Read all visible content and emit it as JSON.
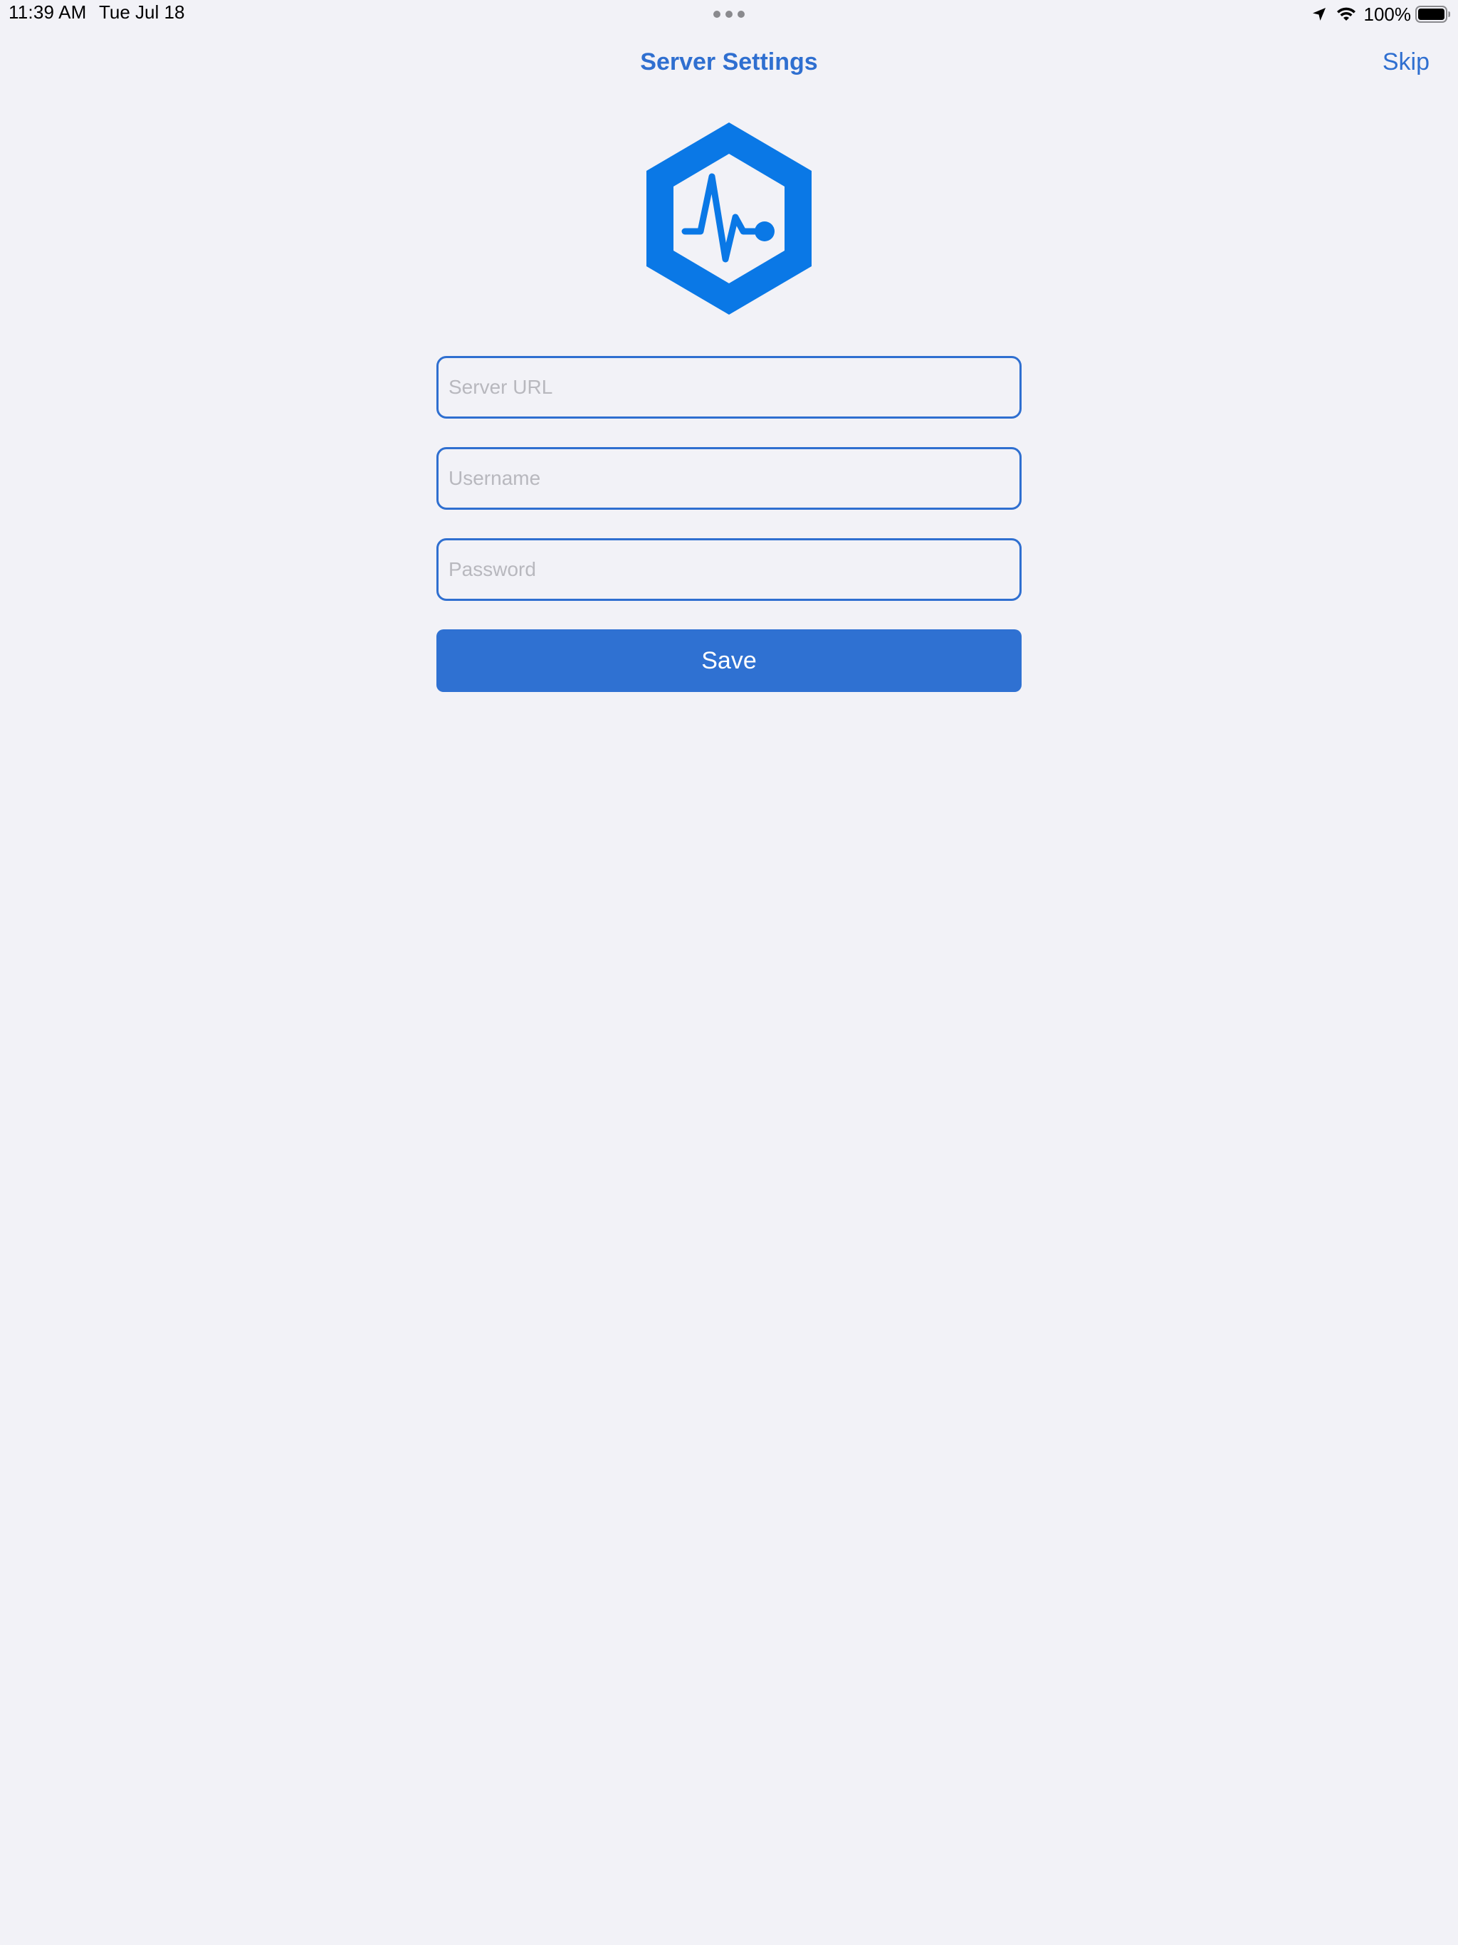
{
  "status_bar": {
    "time": "11:39 AM",
    "date": "Tue Jul 18",
    "battery_percent": "100%",
    "icons": [
      "location-arrow-icon",
      "wifi-icon",
      "battery-icon"
    ]
  },
  "nav": {
    "title": "Server Settings",
    "skip_label": "Skip"
  },
  "logo": {
    "icon": "hexagon-heartbeat-logo",
    "color": "#0a78e6"
  },
  "form": {
    "server_url": {
      "value": "",
      "placeholder": "Server URL"
    },
    "username": {
      "value": "",
      "placeholder": "Username"
    },
    "password": {
      "value": "",
      "placeholder": "Password"
    },
    "save_label": "Save"
  },
  "colors": {
    "accent": "#2f6fd0",
    "background": "#f2f2f7",
    "button": "#2f71d2",
    "placeholder": "#b8b8be"
  }
}
